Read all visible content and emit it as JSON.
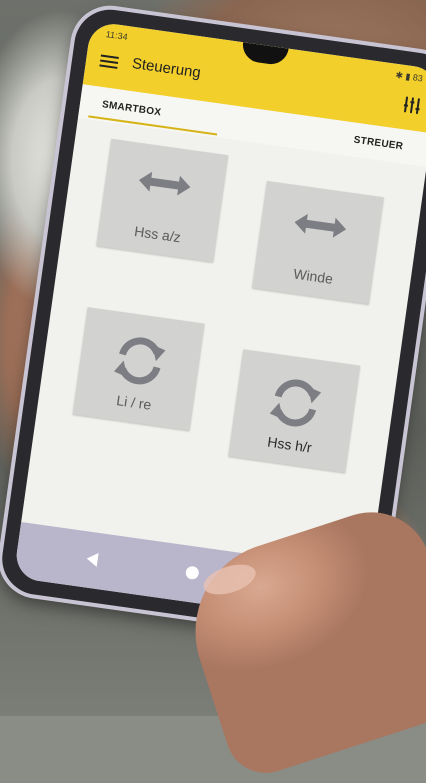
{
  "statusbar": {
    "time": "11:34",
    "right": "✱ ▮ 83"
  },
  "appbar": {
    "title": "Steuerung",
    "menu_icon": "hamburger-menu-icon",
    "settings_icon": "tune-sliders-icon",
    "color": "#f2cf2a"
  },
  "tabs": [
    {
      "label": "SMARTBOX",
      "active": true
    },
    {
      "label": "STREUER",
      "active": false
    }
  ],
  "tiles": [
    {
      "label": "Hss a/z",
      "icon": "horizontal-arrows-icon"
    },
    {
      "label": "Winde",
      "icon": "horizontal-arrows-icon"
    },
    {
      "label": "Li / re",
      "icon": "rotate-arrows-icon"
    },
    {
      "label": "Hss h/r",
      "icon": "rotate-arrows-icon"
    }
  ],
  "navbar": {
    "back_icon": "nav-back-icon",
    "home_icon": "nav-home-icon"
  }
}
